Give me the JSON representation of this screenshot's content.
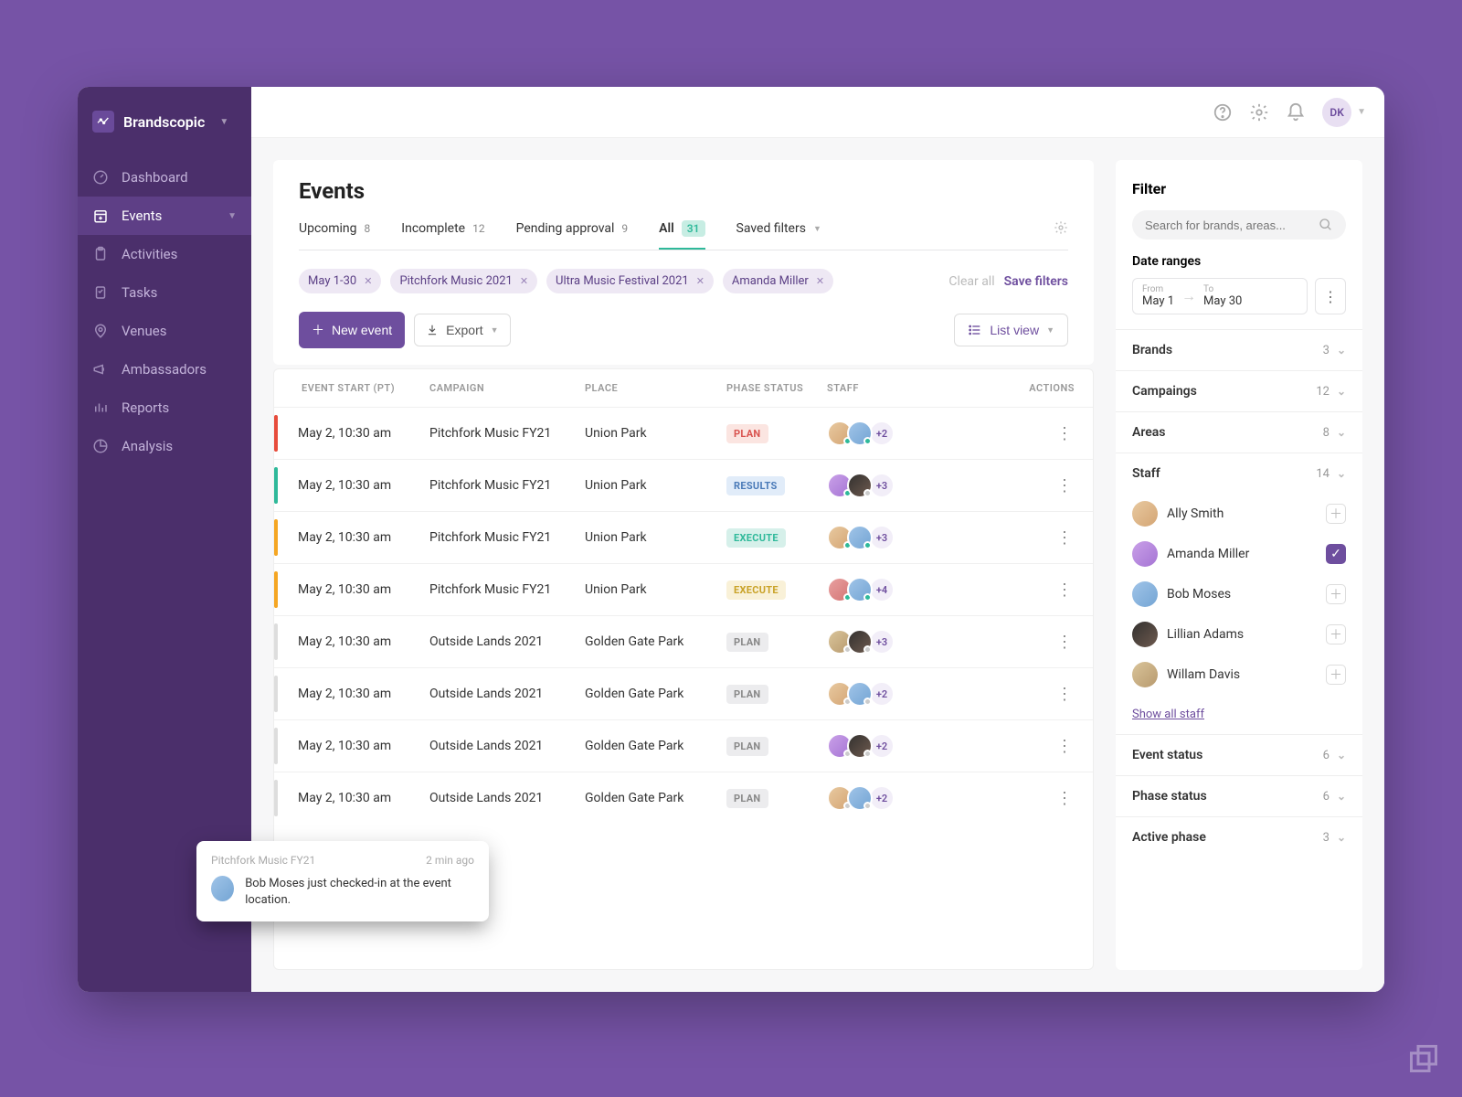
{
  "brand": {
    "name": "Brandscopic"
  },
  "nav": {
    "items": [
      {
        "label": "Dashboard",
        "icon": "gauge"
      },
      {
        "label": "Events",
        "icon": "calendar-plus",
        "active": true,
        "expandable": true
      },
      {
        "label": "Activities",
        "icon": "clipboard"
      },
      {
        "label": "Tasks",
        "icon": "checklist"
      },
      {
        "label": "Venues",
        "icon": "map-pin"
      },
      {
        "label": "Ambassadors",
        "icon": "megaphone"
      },
      {
        "label": "Reports",
        "icon": "bars"
      },
      {
        "label": "Analysis",
        "icon": "pie"
      }
    ]
  },
  "topbar": {
    "user_initials": "DK"
  },
  "page": {
    "title": "Events",
    "tabs": [
      {
        "label": "Upcoming",
        "count": "8"
      },
      {
        "label": "Incomplete",
        "count": "12"
      },
      {
        "label": "Pending approval",
        "count": "9"
      },
      {
        "label": "All",
        "count": "31",
        "active": true
      },
      {
        "label": "Saved filters",
        "dropdown": true
      }
    ],
    "chips": [
      {
        "label": "May 1-30"
      },
      {
        "label": "Pitchfork Music 2021"
      },
      {
        "label": "Ultra Music Festival 2021"
      },
      {
        "label": "Amanda Miller"
      }
    ],
    "clear_label": "Clear all",
    "save_filters_label": "Save filters",
    "new_event_label": "New event",
    "export_label": "Export",
    "view_label": "List view"
  },
  "table": {
    "columns": {
      "start": "EVENT START (PT)",
      "campaign": "CAMPAIGN",
      "place": "PLACE",
      "phase": "PHASE STATUS",
      "staff": "STAFF",
      "actions": "ACTIONS"
    },
    "rows": [
      {
        "bar": "red",
        "start": "May 2, 10:30 am",
        "campaign": "Pitchfork Music FY21",
        "place": "Union Park",
        "phase": "PLAN",
        "phase_cls": "phase-plan-red",
        "more": "+2",
        "av1": "av-a",
        "av2": "av-b",
        "d1": "green",
        "d2": "green"
      },
      {
        "bar": "teal",
        "start": "May 2, 10:30 am",
        "campaign": "Pitchfork Music FY21",
        "place": "Union Park",
        "phase": "RESULTS",
        "phase_cls": "phase-results",
        "more": "+3",
        "av1": "av-c",
        "av2": "av-d",
        "d1": "green",
        "d2": "grey"
      },
      {
        "bar": "orange",
        "start": "May 2, 10:30 am",
        "campaign": "Pitchfork Music FY21",
        "place": "Union Park",
        "phase": "EXECUTE",
        "phase_cls": "phase-execute-teal",
        "more": "+3",
        "av1": "av-a",
        "av2": "av-b",
        "d1": "green",
        "d2": "green"
      },
      {
        "bar": "orange",
        "start": "May 2, 10:30 am",
        "campaign": "Pitchfork Music FY21",
        "place": "Union Park",
        "phase": "EXECUTE",
        "phase_cls": "phase-execute-yellow",
        "more": "+4",
        "av1": "av-e",
        "av2": "av-b",
        "d1": "green",
        "d2": "green"
      },
      {
        "bar": "grey",
        "start": "May 2, 10:30 am",
        "campaign": "Outside Lands 2021",
        "place": "Golden Gate Park",
        "phase": "PLAN",
        "phase_cls": "phase-plan-grey",
        "more": "+3",
        "av1": "av-f",
        "av2": "av-d",
        "d1": "grey",
        "d2": "grey"
      },
      {
        "bar": "grey",
        "start": "May 2, 10:30 am",
        "campaign": "Outside Lands 2021",
        "place": "Golden Gate Park",
        "phase": "PLAN",
        "phase_cls": "phase-plan-grey",
        "more": "+2",
        "av1": "av-a",
        "av2": "av-b",
        "d1": "grey",
        "d2": "grey"
      },
      {
        "bar": "grey",
        "start": "May 2, 10:30 am",
        "campaign": "Outside Lands 2021",
        "place": "Golden Gate Park",
        "phase": "PLAN",
        "phase_cls": "phase-plan-grey",
        "more": "+2",
        "av1": "av-c",
        "av2": "av-d",
        "d1": "grey",
        "d2": "grey"
      },
      {
        "bar": "grey",
        "start": "May 2, 10:30 am",
        "campaign": "Outside Lands 2021",
        "place": "Golden Gate Park",
        "phase": "PLAN",
        "phase_cls": "phase-plan-grey",
        "more": "+2",
        "av1": "av-a",
        "av2": "av-b",
        "d1": "grey",
        "d2": "grey"
      }
    ]
  },
  "filter": {
    "title": "Filter",
    "search_placeholder": "Search for brands, areas...",
    "date_label": "Date ranges",
    "from_label": "From",
    "to_label": "To",
    "from_value": "May 1",
    "to_value": "May 30",
    "sections": {
      "brands": {
        "label": "Brands",
        "count": "3"
      },
      "campaigns": {
        "label": "Campaings",
        "count": "12"
      },
      "areas": {
        "label": "Areas",
        "count": "8"
      },
      "staff": {
        "label": "Staff",
        "count": "14"
      },
      "event_status": {
        "label": "Event status",
        "count": "6"
      },
      "phase_status": {
        "label": "Phase status",
        "count": "6"
      },
      "active_phase": {
        "label": "Active phase",
        "count": "3"
      }
    },
    "staff": [
      {
        "name": "Ally Smith",
        "checked": false,
        "av": "av-a"
      },
      {
        "name": "Amanda Miller",
        "checked": true,
        "av": "av-c"
      },
      {
        "name": "Bob Moses",
        "checked": false,
        "av": "av-b"
      },
      {
        "name": "Lillian Adams",
        "checked": false,
        "av": "av-d"
      },
      {
        "name": "Willam Davis",
        "checked": false,
        "av": "av-f"
      }
    ],
    "show_all": "Show all staff"
  },
  "toast": {
    "title": "Pitchfork Music FY21",
    "time": "2 min ago",
    "message": "Bob Moses just checked-in at the event location."
  }
}
